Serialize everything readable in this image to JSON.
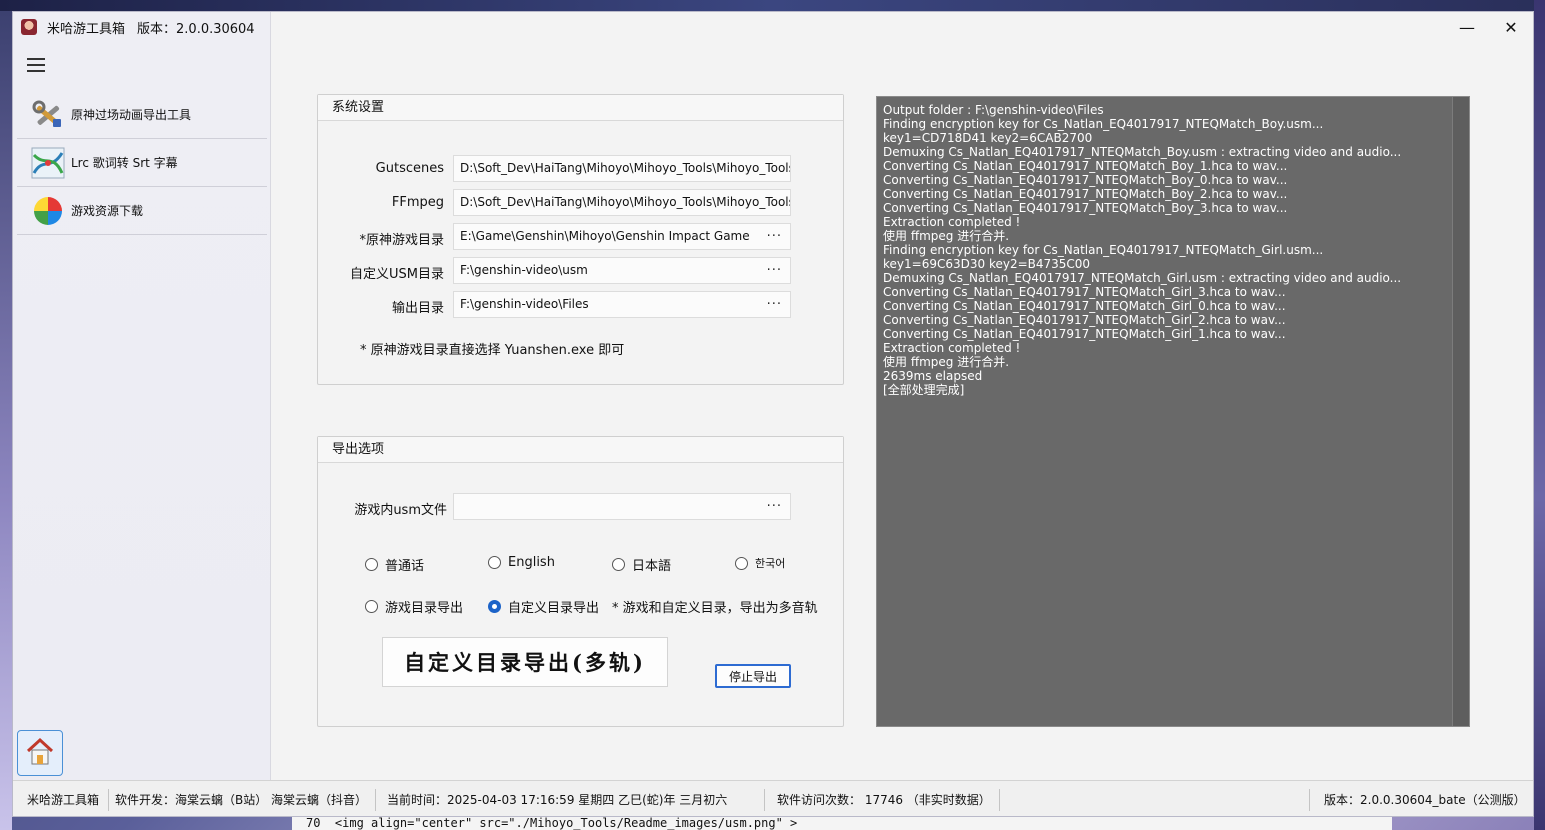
{
  "app": {
    "title": "米哈游工具箱",
    "version_label": "版本：2.0.0.30604"
  },
  "window_controls": {
    "minimize": "—",
    "close": "✕"
  },
  "sidebar": {
    "items": [
      {
        "label": "原神过场动画导出工具",
        "icon": "tools-icon"
      },
      {
        "label": "Lrc 歌词转 Srt 字幕",
        "icon": "subtitle-icon"
      },
      {
        "label": "游戏资源下载",
        "icon": "pinwheel-icon"
      }
    ]
  },
  "system_settings": {
    "title": "系统设置",
    "rows": [
      {
        "label": "Gutscenes",
        "value": "D:\\Soft_Dev\\HaiTang\\Mihoyo\\Mihoyo_Tools\\Mihoyo_Tools\\"
      },
      {
        "label": "FFmpeg",
        "value": "D:\\Soft_Dev\\HaiTang\\Mihoyo\\Mihoyo_Tools\\Mihoyo_Tools\\"
      },
      {
        "label": "*原神游戏目录",
        "value": "E:\\Game\\Genshin\\Mihoyo\\Genshin Impact Game",
        "browse": "···"
      },
      {
        "label": "自定义USM目录",
        "value": "F:\\genshin-video\\usm",
        "browse": "···"
      },
      {
        "label": "输出目录",
        "value": "F:\\genshin-video\\Files",
        "browse": "···"
      }
    ],
    "note": "* 原神游戏目录直接选择 Yuanshen.exe 即可"
  },
  "export_options": {
    "title": "导出选项",
    "usm_label": "游戏内usm文件",
    "usm_value": "",
    "usm_browse": "···",
    "languages": [
      {
        "label": "普通话",
        "selected": false
      },
      {
        "label": "English",
        "selected": false
      },
      {
        "label": "日本語",
        "selected": false
      },
      {
        "label": "한국어",
        "selected": false
      }
    ],
    "modes": [
      {
        "label": "游戏目录导出",
        "selected": false
      },
      {
        "label": "自定义目录导出",
        "selected": true
      }
    ],
    "mode_note": "* 游戏和自定义目录，导出为多音轨",
    "export_button": "自定义目录导出(多轨)",
    "stop_button": "停止导出"
  },
  "log": {
    "lines": [
      "Output folder : F:\\genshin-video\\Files",
      "Finding encryption key for Cs_Natlan_EQ4017917_NTEQMatch_Boy.usm...",
      "key1=CD718D41 key2=6CAB2700",
      "Demuxing Cs_Natlan_EQ4017917_NTEQMatch_Boy.usm : extracting video and audio...",
      "Converting Cs_Natlan_EQ4017917_NTEQMatch_Boy_1.hca to wav...",
      "Converting Cs_Natlan_EQ4017917_NTEQMatch_Boy_0.hca to wav...",
      "Converting Cs_Natlan_EQ4017917_NTEQMatch_Boy_2.hca to wav...",
      "Converting Cs_Natlan_EQ4017917_NTEQMatch_Boy_3.hca to wav...",
      "Extraction completed !",
      "使用 ffmpeg 进行合并.",
      "Finding encryption key for Cs_Natlan_EQ4017917_NTEQMatch_Girl.usm...",
      "key1=69C63D30 key2=B4735C00",
      "Demuxing Cs_Natlan_EQ4017917_NTEQMatch_Girl.usm : extracting video and audio...",
      "Converting Cs_Natlan_EQ4017917_NTEQMatch_Girl_3.hca to wav...",
      "Converting Cs_Natlan_EQ4017917_NTEQMatch_Girl_0.hca to wav...",
      "Converting Cs_Natlan_EQ4017917_NTEQMatch_Girl_2.hca to wav...",
      "Converting Cs_Natlan_EQ4017917_NTEQMatch_Girl_1.hca to wav...",
      "Extraction completed !",
      "使用 ffmpeg 进行合并.",
      "2639ms elapsed",
      "[全部处理完成]"
    ]
  },
  "statusbar": {
    "app_name": "米哈游工具箱",
    "developer": "软件开发：海棠云螭（B站）  海棠云螭（抖音）",
    "time": "当前时间：2025-04-03 17:16:59  星期四    乙巳(蛇)年 三月初六",
    "visits": "软件访问次数：  17746  （非实时数据）",
    "version": "版本：2.0.0.30604_bate（公测版）"
  },
  "editor_line": "70  <img align=\"center\" src=\"./Mihoyo_Tools/Readme_images/usm.png\" >"
}
